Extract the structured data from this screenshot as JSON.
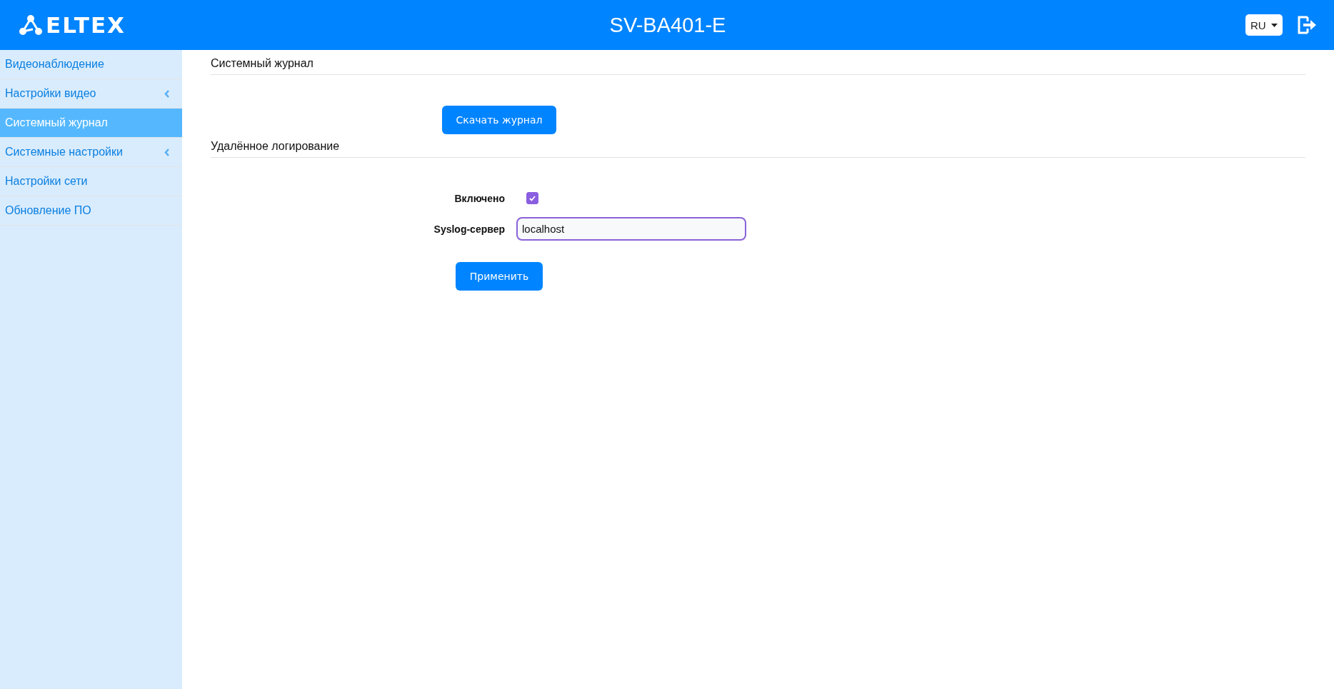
{
  "header": {
    "logo": "ELTEX",
    "title": "SV-BA401-E",
    "language": "RU"
  },
  "sidebar": {
    "items": [
      {
        "label": "Видеонаблюдение",
        "selected": false,
        "expandable": false
      },
      {
        "label": "Настройки видео",
        "selected": false,
        "expandable": true
      },
      {
        "label": "Системный журнал",
        "selected": true,
        "expandable": false
      },
      {
        "label": "Системные настройки",
        "selected": false,
        "expandable": true
      },
      {
        "label": "Настройки сети",
        "selected": false,
        "expandable": false
      },
      {
        "label": "Обновление ПО",
        "selected": false,
        "expandable": false
      }
    ]
  },
  "system_log": {
    "title": "Системный журнал",
    "download_button": "Скачать журнал"
  },
  "remote_logging": {
    "title": "Удалённое логирование",
    "enabled": {
      "label": "Включено",
      "checked": true
    },
    "server": {
      "label": "Syslog-сервер",
      "value": "localhost",
      "focused": true
    },
    "apply_button": "Применить"
  }
}
